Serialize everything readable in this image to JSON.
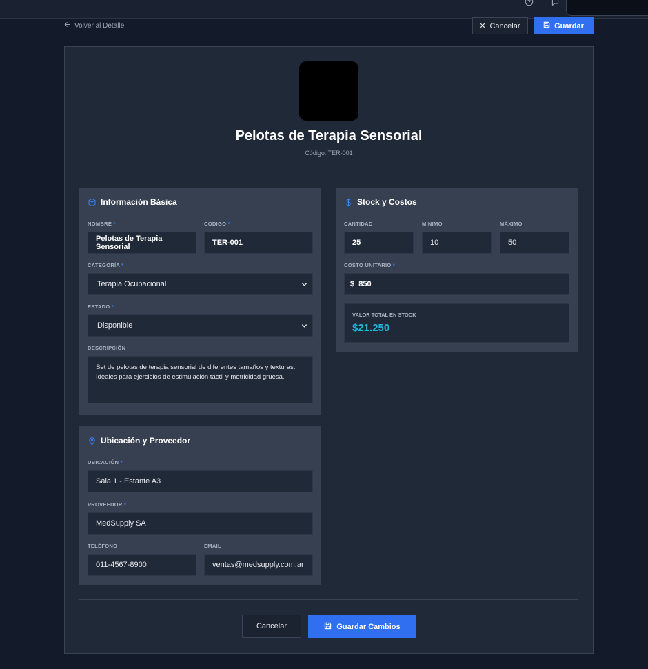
{
  "header": {
    "back_label": "Volver al Detalle",
    "cancel_label": "Cancelar",
    "save_label": "Guardar"
  },
  "product": {
    "title": "Pelotas de Terapia Sensorial",
    "code_line": "Código: TER-001"
  },
  "basic_info": {
    "title": "Información Básica",
    "name_label": "NOMBRE",
    "name_value": "Pelotas de Terapia Sensorial",
    "code_label": "CÓDIGO",
    "code_value": "TER-001",
    "category_label": "CATEGORÍA",
    "category_value": "Terapia Ocupacional",
    "status_label": "ESTADO",
    "status_value": "Disponible",
    "description_label": "DESCRIPCIÓN",
    "description_value": "Set de pelotas de terapia sensorial de diferentes tamaños y texturas. Ideales para ejercicios de estimulación táctil y motricidad gruesa."
  },
  "stock": {
    "title": "Stock y Costos",
    "quantity_label": "CANTIDAD",
    "quantity_value": "25",
    "min_label": "MÍNIMO",
    "min_value": "10",
    "max_label": "MÁXIMO",
    "max_value": "50",
    "unit_cost_label": "COSTO UNITARIO",
    "unit_cost_value": "$  850",
    "total_label": "VALOR TOTAL EN STOCK",
    "total_value": "$21.250"
  },
  "location": {
    "title": "Ubicación y Proveedor",
    "location_label": "UBICACIÓN",
    "location_value": "Sala 1 - Estante A3",
    "supplier_label": "PROVEEDOR",
    "supplier_value": "MedSupply SA",
    "phone_label": "TELÉFONO",
    "phone_value": "011-4567-8900",
    "email_label": "EMAIL",
    "email_value": "ventas@medsupply.com.ar"
  },
  "footer": {
    "cancel_label": "Cancelar",
    "save_label": "Guardar Cambios"
  },
  "required_marker": "*",
  "colors": {
    "accent": "#2f6ff0",
    "total_value": "#22b5d8",
    "background": "#131a2a",
    "card": "#202938",
    "panel": "#364051"
  }
}
